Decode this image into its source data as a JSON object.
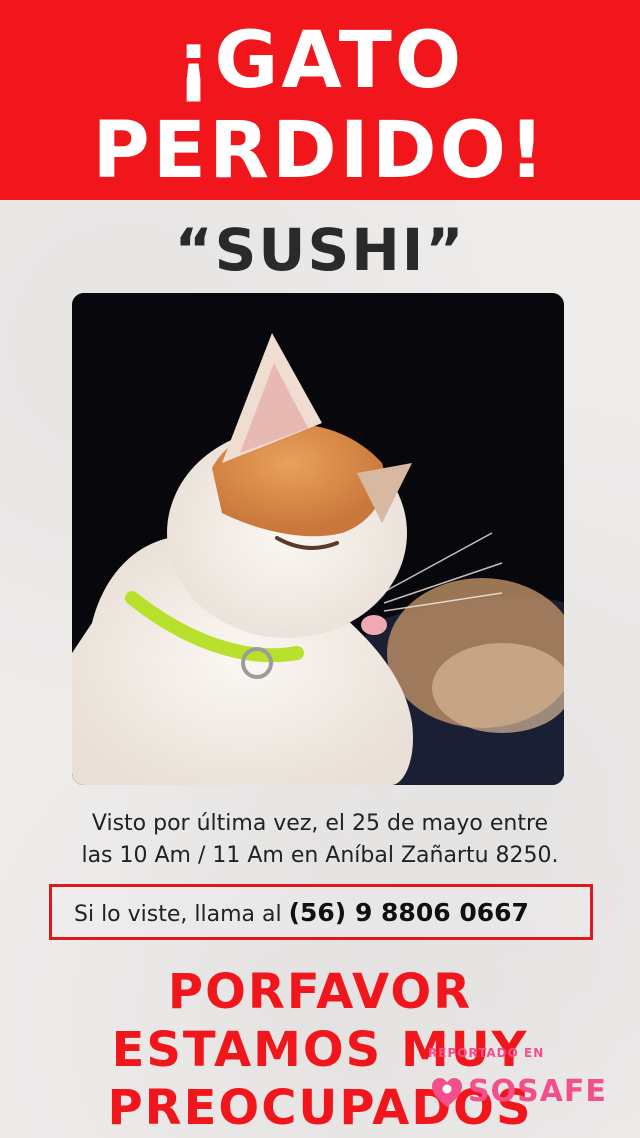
{
  "header": {
    "line1": "¡GATO",
    "line2": "PERDIDO!"
  },
  "cat": {
    "name": "“SUSHI”",
    "photo_icon": "cat-photo"
  },
  "details": {
    "seen_line1": "Visto por última vez, el 25 de mayo entre",
    "seen_line2": "las 10 Am / 11 Am en Aníbal Zañartu 8250."
  },
  "contact": {
    "prefix": "Si lo viste, llama al",
    "phone": "(56) 9 8806 0667"
  },
  "plea": {
    "line1": "PORFAVOR",
    "line2": "ESTAMOS MUY",
    "line3": "PREOCUPADOS"
  },
  "watermark": {
    "caption": "REPORTADO EN",
    "brand": "SOSAFE",
    "icon": "sosafe-heart-logo"
  },
  "colors": {
    "accent_red": "#f1161c",
    "brand_pink": "#f24f8c",
    "text_dark": "#222222"
  }
}
